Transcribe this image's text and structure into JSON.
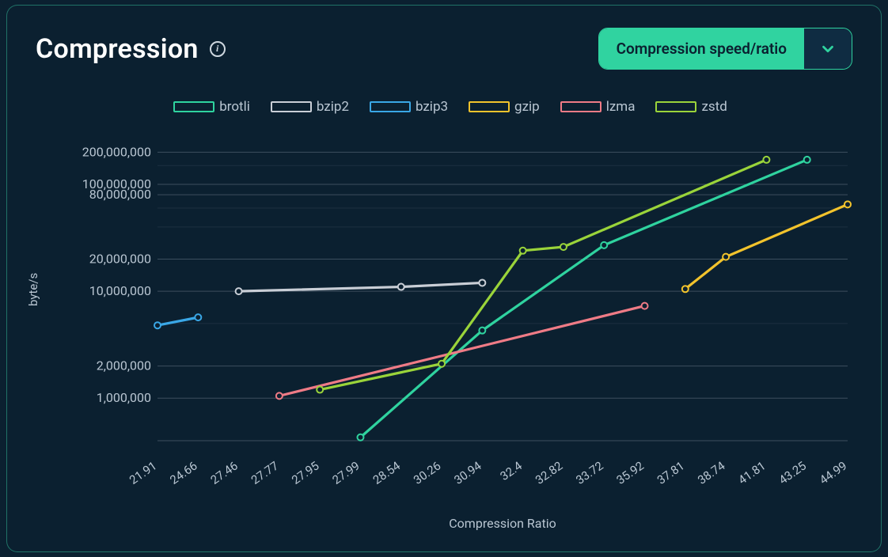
{
  "header": {
    "title": "Compression",
    "info_tooltip": "i"
  },
  "selector": {
    "label": "Compression speed/ratio"
  },
  "chart_data": {
    "type": "line",
    "title": "Compression",
    "xlabel": "Compression Ratio",
    "ylabel": "byte/s",
    "yscale": "log",
    "ylim": [
      400000,
      260000000
    ],
    "yticks": [
      1000000,
      2000000,
      10000000,
      20000000,
      80000000,
      100000000,
      200000000
    ],
    "ytick_labels": [
      "1,000,000",
      "2,000,000",
      "10,000,000",
      "20,000,000",
      "80,000,000",
      "100,000,000",
      "200,000,000"
    ],
    "categories": [
      21.91,
      24.66,
      27.46,
      27.77,
      27.95,
      27.99,
      28.54,
      30.26,
      30.94,
      32.4,
      32.82,
      33.72,
      35.92,
      37.81,
      38.74,
      41.81,
      43.25,
      44.99
    ],
    "colors": {
      "brotli": "#2fd39f",
      "bzip2": "#c9ced6",
      "bzip3": "#3aa7e6",
      "gzip": "#f2c32c",
      "lzma": "#ef7b86",
      "zstd": "#9ad43a"
    },
    "series": [
      {
        "name": "brotli",
        "points": [
          {
            "x": 27.99,
            "y": 430000
          },
          {
            "x": 30.94,
            "y": 4300000
          },
          {
            "x": 33.72,
            "y": 27000000
          },
          {
            "x": 43.25,
            "y": 170000000
          }
        ]
      },
      {
        "name": "bzip2",
        "points": [
          {
            "x": 27.46,
            "y": 10000000
          },
          {
            "x": 28.54,
            "y": 11000000
          },
          {
            "x": 30.94,
            "y": 12000000
          }
        ]
      },
      {
        "name": "bzip3",
        "points": [
          {
            "x": 21.91,
            "y": 4800000
          },
          {
            "x": 24.66,
            "y": 5700000
          }
        ]
      },
      {
        "name": "gzip",
        "points": [
          {
            "x": 37.81,
            "y": 10500000
          },
          {
            "x": 38.74,
            "y": 21000000
          },
          {
            "x": 44.99,
            "y": 65000000
          }
        ]
      },
      {
        "name": "lzma",
        "points": [
          {
            "x": 27.77,
            "y": 1050000
          },
          {
            "x": 35.92,
            "y": 7300000
          }
        ]
      },
      {
        "name": "zstd",
        "points": [
          {
            "x": 27.95,
            "y": 1200000
          },
          {
            "x": 30.26,
            "y": 2100000
          },
          {
            "x": 32.4,
            "y": 24000000
          },
          {
            "x": 32.82,
            "y": 26000000
          },
          {
            "x": 41.81,
            "y": 170000000
          }
        ]
      }
    ],
    "legend_order": [
      "brotli",
      "bzip2",
      "bzip3",
      "gzip",
      "lzma",
      "zstd"
    ]
  }
}
